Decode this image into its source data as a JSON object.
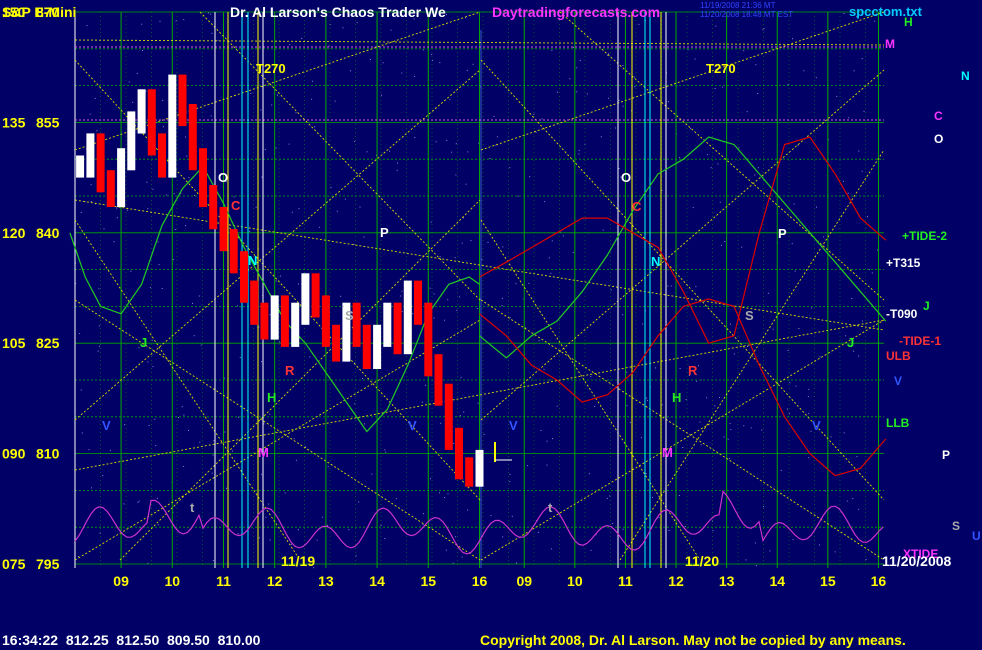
{
  "header": {
    "instrument": "S&P E-Mini",
    "author_title": "Dr. Al Larson's Chaos Trader We",
    "website": "Daytradingforecasts.com",
    "stamp_line1": "11/19/2008 21:36 MT",
    "stamp_line2": "11/20/2008 18:48 MT EST",
    "file_name": "spcctom.txt"
  },
  "footer": {
    "quote": "16:34:22  812.25  812.50  809.50  810.00",
    "copyright": "Copyright 2008, Dr. Al Larson. May not be copied by any means.",
    "current_date": "11/20/2008"
  },
  "colors": {
    "background": "#000066",
    "grid": "#00aa00",
    "price_up": "#ffffff",
    "price_down": "#ff0000",
    "red_curve": "#dd0000",
    "green_curve": "#22cc22",
    "magenta_curve": "#cc33cc",
    "yellow_lines": "#dddd00",
    "cyan_line": "#00ffff"
  },
  "chart_data": {
    "type": "line",
    "title": "S&P E-Mini",
    "y_ticks_price": [
      "870",
      "855",
      "840",
      "825",
      "810",
      "795"
    ],
    "y_ticks_left": [
      "150",
      "135",
      "120",
      "105",
      "090",
      "075"
    ],
    "ylim": [
      795,
      870
    ],
    "x_ticks": [
      "09",
      "10",
      "11",
      "12",
      "13",
      "14",
      "15",
      "16",
      "09",
      "10",
      "11",
      "12",
      "13",
      "14",
      "15",
      "16"
    ],
    "day_labels": [
      "11/19",
      "11/20"
    ],
    "series": [
      {
        "type": "bars",
        "x": [
          8.2,
          8.4,
          8.6,
          8.8,
          9.0,
          9.2,
          9.4,
          9.6,
          9.8,
          10.0,
          10.2,
          10.4,
          10.6,
          10.8,
          11.0,
          11.2,
          11.4,
          11.6,
          11.8,
          12.0,
          12.2,
          12.4,
          12.6,
          12.8,
          13.0,
          13.2,
          13.4,
          13.6,
          13.8,
          14.0,
          14.2,
          14.4,
          14.6,
          14.8,
          15.0,
          15.2,
          15.4,
          15.6,
          15.8,
          16.0
        ],
        "values": [
          849,
          852,
          847,
          845,
          850,
          855,
          858,
          852,
          849,
          860,
          856,
          850,
          845,
          842,
          839,
          836,
          832,
          829,
          827,
          830,
          826,
          829,
          833,
          830,
          826,
          824,
          829,
          826,
          823,
          826,
          829,
          825,
          832,
          829,
          822,
          818,
          812,
          808,
          807,
          809
        ]
      },
      {
        "name": "TIDE",
        "x": [
          8.0,
          8.3,
          8.6,
          9.0,
          9.4,
          9.8,
          10.2,
          10.6,
          11.0,
          11.4,
          11.8,
          12.2,
          12.6,
          13.0,
          13.4,
          13.8,
          14.2,
          14.6,
          15.0,
          15.4,
          15.8,
          16.0
        ],
        "values": [
          840,
          834,
          830,
          829,
          833,
          841,
          846,
          849,
          844,
          838,
          833,
          828,
          825,
          821,
          817,
          813,
          816,
          822,
          829,
          833,
          834,
          833
        ]
      },
      {
        "name": "",
        "x": [
          16.0,
          16.5,
          17.0,
          17.5,
          18.0,
          18.5,
          19.0,
          19.5,
          20.0,
          20.5,
          21.0,
          21.5,
          22.0,
          22.5,
          23.0,
          23.5,
          24.0
        ],
        "values": [
          826,
          823,
          826,
          828,
          832,
          837,
          843,
          848,
          850,
          853,
          852,
          848,
          844,
          840,
          836,
          832,
          828
        ]
      },
      {
        "name": "",
        "x": [
          16.0,
          16.5,
          17.0,
          17.5,
          18.0,
          18.5,
          19.0,
          19.5,
          20.0,
          20.5,
          21.0,
          21.5,
          22.0,
          22.5,
          23.0,
          23.5,
          24.0
        ],
        "values": [
          834,
          836,
          838,
          840,
          842,
          842,
          840,
          838,
          832,
          825,
          826,
          840,
          852,
          853,
          848,
          842,
          839
        ]
      },
      {
        "name": "",
        "x": [
          16.0,
          16.5,
          17.0,
          17.5,
          18.0,
          18.5,
          19.0,
          19.5,
          20.0,
          20.5,
          21.0,
          21.5,
          22.0,
          22.5,
          23.0,
          23.5,
          24.0
        ],
        "values": [
          829,
          826,
          822,
          820,
          817,
          818,
          821,
          826,
          830,
          831,
          830,
          822,
          815,
          810,
          807,
          808,
          812
        ]
      }
    ],
    "level_labels_right": [
      "H",
      "M",
      "N",
      "C",
      "O",
      "+TIDE-2",
      "+T315",
      "J",
      "-T090",
      "-TIDE-1",
      "ULB",
      "V",
      "LLB",
      "P",
      "S",
      "U",
      "XTIDE"
    ],
    "chart_letters": [
      "O",
      "C",
      "N",
      "P",
      "S",
      "R",
      "H",
      "J",
      "M",
      "V",
      "V",
      "t",
      "T270",
      "O",
      "C",
      "N",
      "P",
      "S",
      "R",
      "H",
      "J",
      "M",
      "V",
      "V",
      "t",
      "T270"
    ]
  }
}
